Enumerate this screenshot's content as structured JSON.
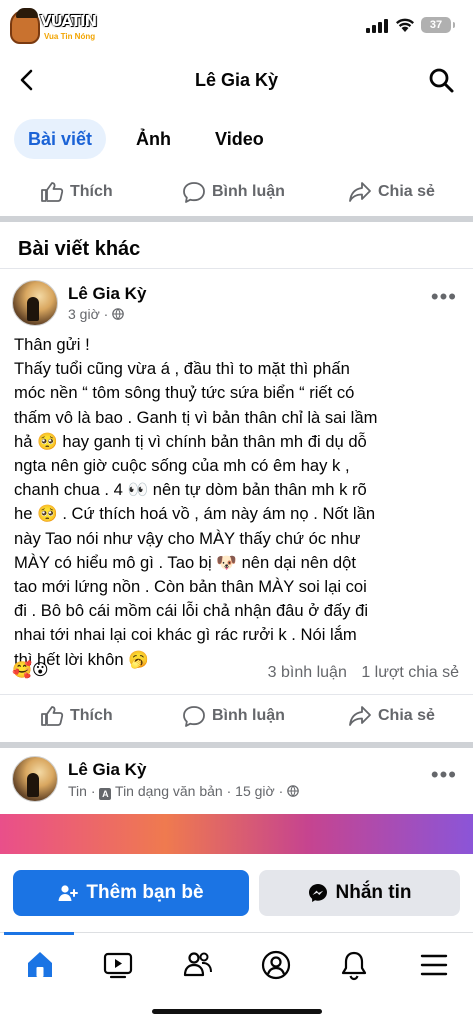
{
  "watermark": {
    "brand": "VUA",
    "brand_highlight": "TIN",
    "tagline": "Vua Tin Nóng"
  },
  "status_bar": {
    "battery": "37"
  },
  "header": {
    "title": "Lê Gia Kỳ"
  },
  "tabs": [
    {
      "label": "Bài viết",
      "active": true
    },
    {
      "label": "Ảnh",
      "active": false
    },
    {
      "label": "Video",
      "active": false
    }
  ],
  "actions": {
    "like": "Thích",
    "comment": "Bình luận",
    "share": "Chia sẻ"
  },
  "section_title": "Bài viết khác",
  "post1": {
    "author": "Lê Gia Kỳ",
    "time": "3 giờ",
    "lines": [
      "Thân gửi !",
      "Thấy tuổi cũng vừa á , đầu thì to mặt thì phấn",
      "móc nền “ tôm sông thuỷ tức sứa biển “ riết có",
      "thấm vô là bao . Ganh tị vì bản thân chỉ là sai lầm",
      "hả 🥺 hay ganh tị vì chính bản thân mh đi dụ dỗ",
      "ngta nên giờ cuộc sống của mh có êm hay k ,",
      "chanh chua . 4 👀 nên tự dòm bản thân mh k rõ",
      "he 🥺 . Cứ thích hoá vồ , ám này ám nọ . Nốt lần",
      "này Tao nói như vậy cho MÀY thấy chứ óc như",
      "MÀY có hiểu mô gì . Tao bị 🐶 nên dại nên dột",
      "tao mới lứng nồn . Còn bản thân MÀY soi lại coi",
      "đi . Bô bô cái mồm cái lỗi chả nhận đâu ở đấy đi",
      "nhai tới nhai lại coi khác gì rác rưởi k . Nói lắm",
      "thì hết lời khôn 🥱"
    ],
    "reactions": "🥰😮",
    "comments": "3 bình luận",
    "shares": "1 lượt chia sẻ"
  },
  "post2": {
    "author": "Lê Gia Kỳ",
    "meta_prefix": "Tin",
    "meta_type": "Tin dạng văn bản",
    "time": "15 giờ"
  },
  "buttons": {
    "add_friend": "Thêm bạn bè",
    "message": "Nhắn tin"
  },
  "nav": [
    "home-icon",
    "video-icon",
    "friends-icon",
    "profile-icon",
    "bell-icon",
    "menu-icon"
  ],
  "colors": {
    "accent": "#1b74e4",
    "tab_active_bg": "#e7f1fd",
    "muted": "#65676b"
  }
}
